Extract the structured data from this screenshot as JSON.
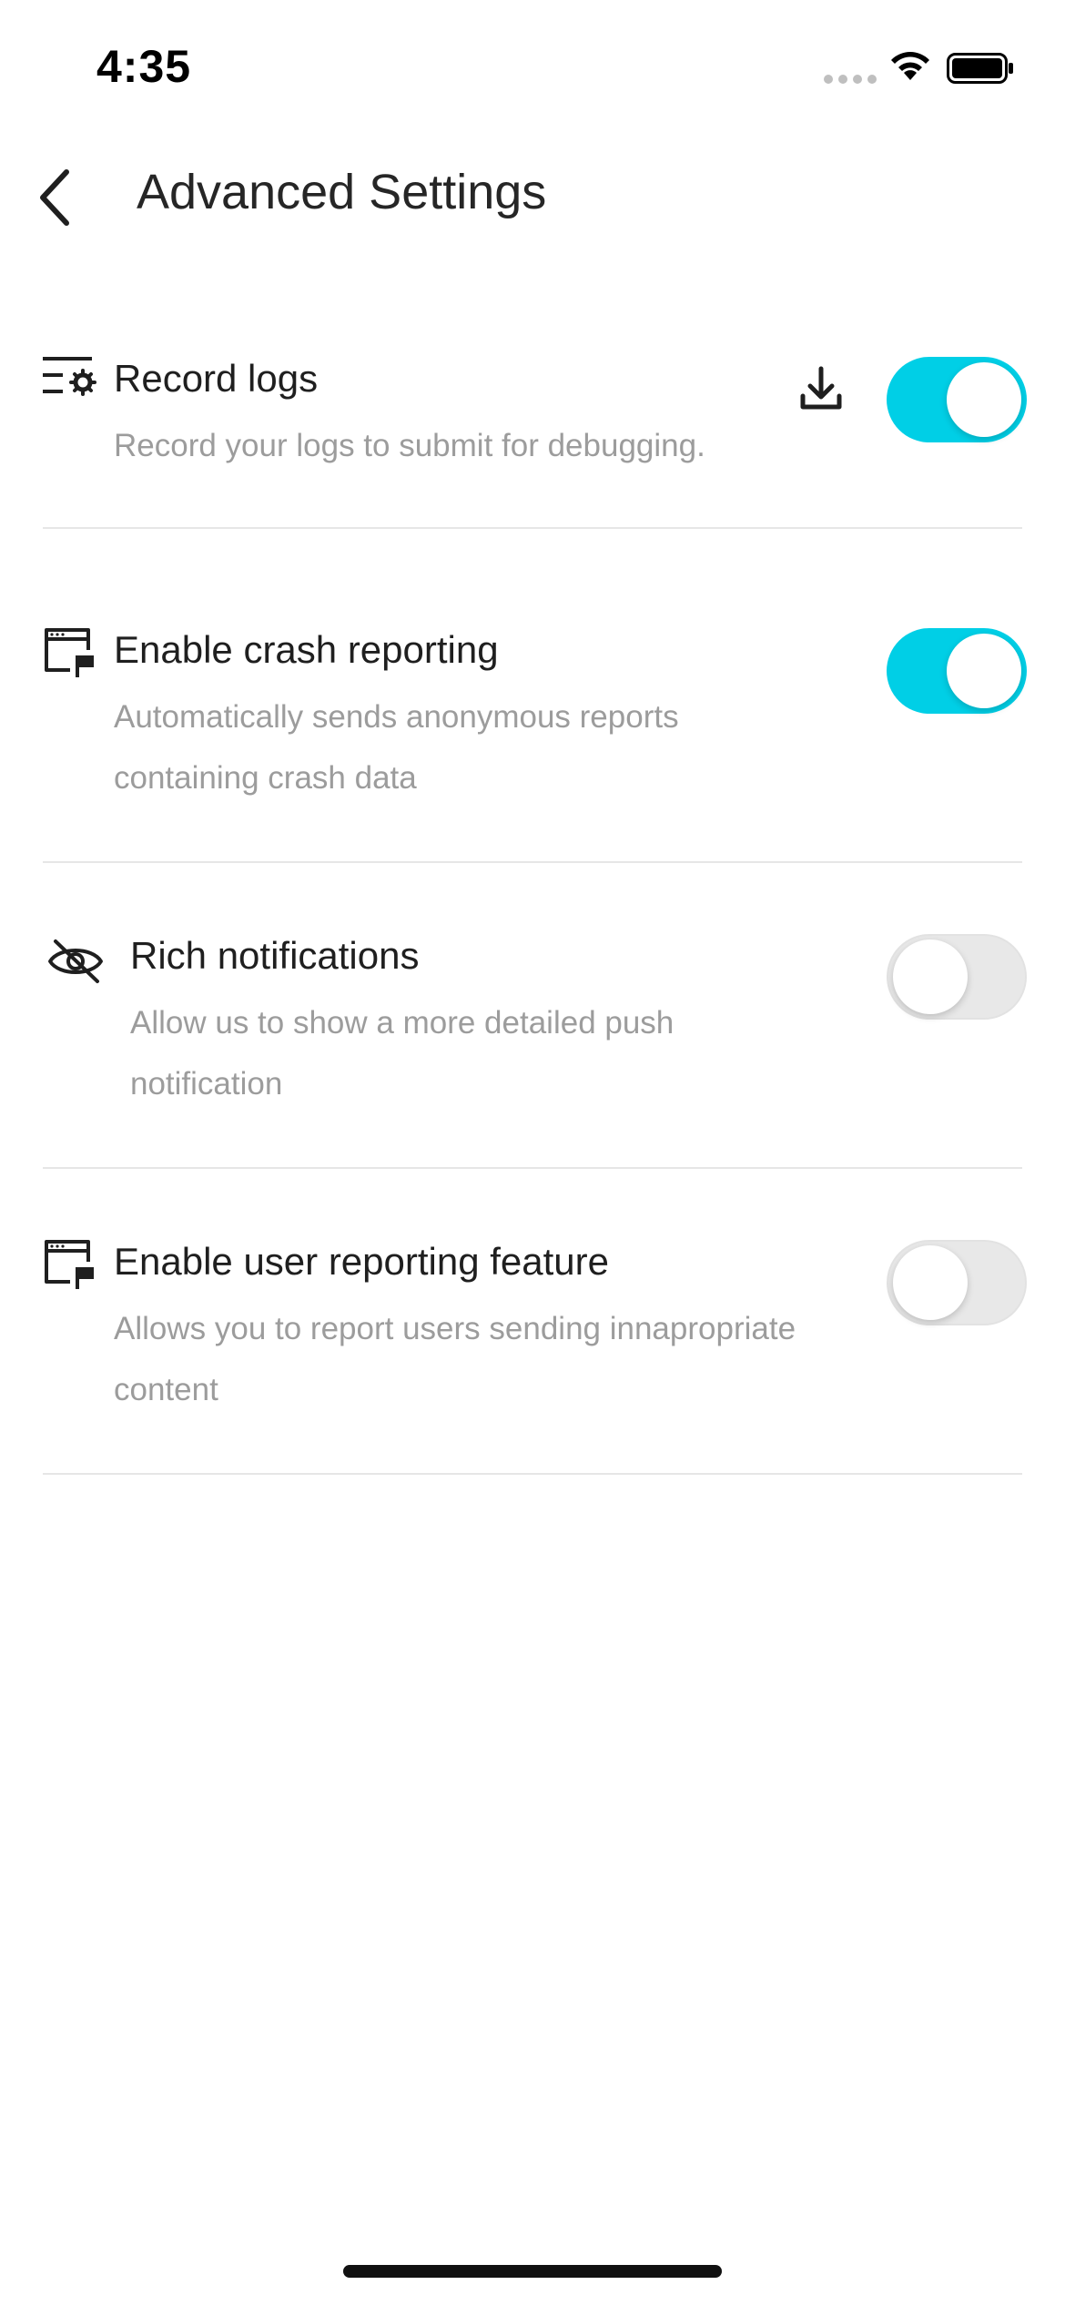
{
  "status_bar": {
    "time": "4:35"
  },
  "header": {
    "title": "Advanced Settings"
  },
  "settings": [
    {
      "title": "Record logs",
      "description": "Record your logs to submit for debugging.",
      "icon": "log-settings-icon",
      "enabled": true,
      "has_download": true
    },
    {
      "title": "Enable crash reporting",
      "description": "Automatically sends anonymous reports containing crash data",
      "icon": "window-flag-icon",
      "enabled": true
    },
    {
      "title": "Rich notifications",
      "description": "Allow us to show a more detailed push notification",
      "icon": "eye-off-icon",
      "enabled": false
    },
    {
      "title": "Enable user reporting feature",
      "description": "Allows you to report users sending innapropriate content",
      "icon": "window-flag-icon",
      "enabled": false
    }
  ],
  "colors": {
    "toggle_on": "#00cfe6",
    "toggle_off": "#e8e8e8",
    "description_text": "#9c9c9c",
    "divider": "#e6e6e6"
  }
}
